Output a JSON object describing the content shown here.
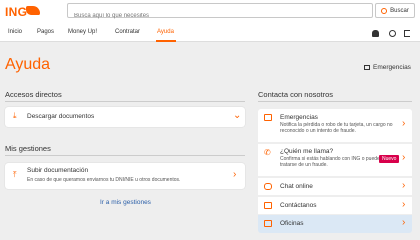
{
  "header": {
    "logo_text": "ING",
    "search_placeholder": "Busca aquí lo que necesites",
    "search_button": "Buscar"
  },
  "nav": {
    "items": [
      "Inicio",
      "Pagos",
      "Money Up!",
      "Contratar",
      "Ayuda"
    ],
    "active": "Ayuda"
  },
  "page": {
    "title": "Ayuda",
    "emergencias_link": "Emergencias"
  },
  "accesos": {
    "heading": "Accesos directos",
    "item": "Descargar documentos"
  },
  "gestiones": {
    "heading": "Mis gestiones",
    "title": "Subir documentación",
    "desc": "En caso de que queramos enviarnos tu DNI/NIE u otros documentos.",
    "link": "Ir a mis gestiones"
  },
  "contacto": {
    "heading": "Contacta con nosotros",
    "items": [
      {
        "title": "Emergencias",
        "desc": "Notifica la pérdida o robo de tu tarjeta, un cargo no reconocido o un intento de fraude.",
        "icon": "card-icon"
      },
      {
        "title": "¿Quién me llama?",
        "desc": "Confirma si estás hablando con ING o puede tratarse de un fraude.",
        "badge": "Nuevo",
        "icon": "phone-icon"
      },
      {
        "title": "Chat online",
        "icon": "chat-icon"
      },
      {
        "title": "Contáctanos",
        "icon": "mail-icon"
      },
      {
        "title": "Oficinas",
        "icon": "office-icon"
      }
    ]
  },
  "colors": {
    "accent": "#ff6200",
    "link": "#2b5fa8",
    "badge": "#d8004b"
  }
}
